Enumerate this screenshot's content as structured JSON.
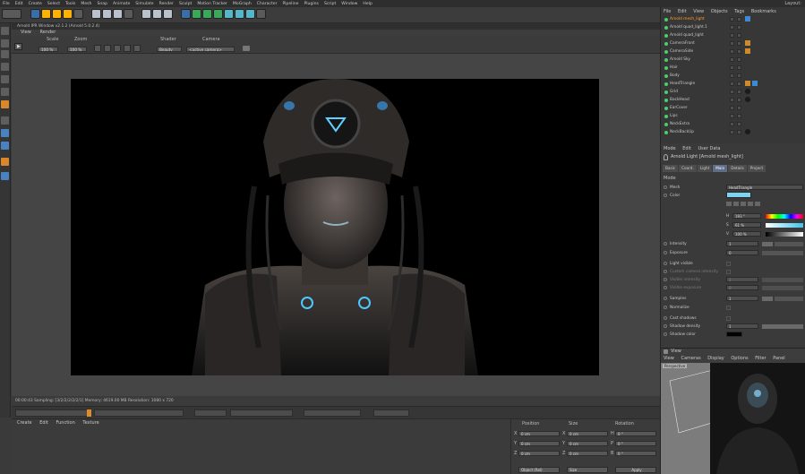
{
  "menubar": {
    "items": [
      "File",
      "Edit",
      "Create",
      "Select",
      "Tools",
      "Mesh",
      "Snap",
      "Animate",
      "Simulate",
      "Render",
      "Sculpt",
      "Motion Tracker",
      "MoGraph",
      "Character",
      "Pipeline",
      "Plugins",
      "Script",
      "Window",
      "Help"
    ],
    "layout_label": "Layout:"
  },
  "ipr": {
    "title": "Arnold IPR Window v2.1.2 (Arnold 5.0.2.4)",
    "menu": [
      "View",
      "Render"
    ],
    "scale_label": "Scale",
    "scale_value": "100 %",
    "zoom_label": "Zoom",
    "zoom_value": "100 %",
    "shader_label": "Shader",
    "shader_value": "Beauty",
    "camera_label": "Camera",
    "camera_value": "<active camera>",
    "status": "00:00:43  Sampling: [3/2/2/2/2/2/1]  Memory: 4619.00 MB  Resolution: 1080 x 720"
  },
  "materials": {
    "menu": [
      "Create",
      "Edit",
      "Function",
      "Texture"
    ]
  },
  "coords": {
    "headers": [
      "Position",
      "Size",
      "Rotation"
    ],
    "rows": [
      {
        "axis": "X",
        "pos": "0 cm",
        "size": "0 cm",
        "rot_axis": "H",
        "rot": "0 °"
      },
      {
        "axis": "Y",
        "pos": "0 cm",
        "size": "0 cm",
        "rot_axis": "P",
        "rot": "0 °"
      },
      {
        "axis": "Z",
        "pos": "0 cm",
        "size": "0 cm",
        "rot_axis": "B",
        "rot": "0 °"
      }
    ],
    "mode": "Object (Rel)",
    "size_mode": "Size",
    "apply": "Apply"
  },
  "objects": {
    "menu": [
      "File",
      "Edit",
      "View",
      "Objects",
      "Tags",
      "Bookmarks"
    ],
    "items": [
      {
        "name": "Arnold mesh_light",
        "highlight": true
      },
      {
        "name": "Arnold quad_light.1",
        "highlight": false
      },
      {
        "name": "Arnold quad_light",
        "highlight": false
      },
      {
        "name": "CameraFront",
        "highlight": false
      },
      {
        "name": "CameraSide",
        "highlight": false
      },
      {
        "name": "Arnold Sky",
        "highlight": false
      },
      {
        "name": "Hair",
        "highlight": false
      },
      {
        "name": "Body",
        "highlight": false
      },
      {
        "name": "HeadTriangle",
        "highlight": false
      },
      {
        "name": "Grid",
        "highlight": false
      },
      {
        "name": "BackHead",
        "highlight": false
      },
      {
        "name": "EarCover",
        "highlight": false
      },
      {
        "name": "Lips",
        "highlight": false
      },
      {
        "name": "NeckExtra",
        "highlight": false
      },
      {
        "name": "NeckBackUp",
        "highlight": false
      }
    ]
  },
  "attributes": {
    "menu": [
      "Mode",
      "Edit",
      "User Data"
    ],
    "title": "Arnold Light [Arnold mesh_light]",
    "tabs": [
      "Basic",
      "Coord.",
      "Light",
      "Main",
      "Details",
      "Project"
    ],
    "active_tab": "Main",
    "section": "Mode",
    "mesh_label": "Mesh",
    "mesh_value": "HeadTriangle",
    "color_label": "Color",
    "h_label": "H",
    "h_value": "193 °",
    "s_label": "S",
    "s_value": "61 %",
    "v_label": "V",
    "v_value": "100 %",
    "intensity_label": "Intensity",
    "intensity_value": "1",
    "exposure_label": "Exposure",
    "exposure_value": "0",
    "light_visible_label": "Light visible",
    "custom_cam_label": "Custom camera intensity",
    "visible_intensity_label": "Visible intensity",
    "visible_intensity_value": "1",
    "visible_exposure_label": "Visible exposure",
    "visible_exposure_value": "0",
    "samples_label": "Samples",
    "samples_value": "1",
    "normalize_label": "Normalize",
    "cast_shadows_label": "Cast shadows",
    "shadow_density_label": "Shadow density",
    "shadow_density_value": "1",
    "shadow_color_label": "Shadow color",
    "light_color": "#7fd3f2"
  },
  "view": {
    "title": "View",
    "menu": [
      "View",
      "Cameras",
      "Display",
      "Options",
      "Filter",
      "Panel"
    ],
    "label": "Perspective"
  }
}
